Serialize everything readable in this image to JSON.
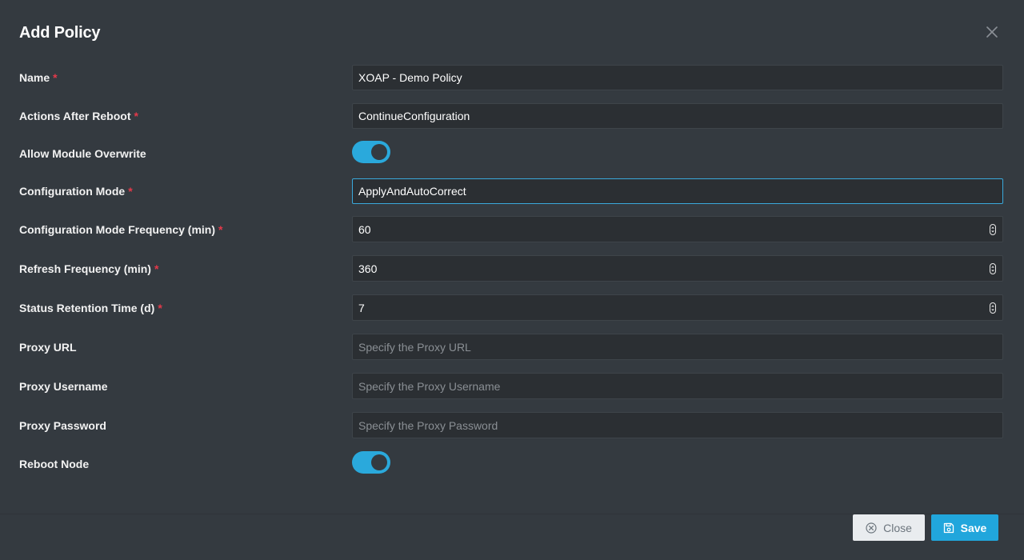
{
  "dialog": {
    "title": "Add Policy"
  },
  "form": {
    "name": {
      "label": "Name",
      "required": "*",
      "value": "XOAP - Demo Policy"
    },
    "actions_after_reboot": {
      "label": "Actions After Reboot",
      "required": "*",
      "value": "ContinueConfiguration"
    },
    "allow_module_overwrite": {
      "label": "Allow Module Overwrite",
      "on": true
    },
    "configuration_mode": {
      "label": "Configuration Mode",
      "required": "*",
      "value": "ApplyAndAutoCorrect"
    },
    "configuration_mode_frequency": {
      "label": "Configuration Mode Frequency (min)",
      "required": "*",
      "value": "60"
    },
    "refresh_frequency": {
      "label": "Refresh Frequency (min)",
      "required": "*",
      "value": "360"
    },
    "status_retention_time": {
      "label": "Status Retention Time (d)",
      "required": "*",
      "value": "7"
    },
    "proxy_url": {
      "label": "Proxy URL",
      "placeholder": "Specify the Proxy URL"
    },
    "proxy_username": {
      "label": "Proxy Username",
      "placeholder": "Specify the Proxy Username"
    },
    "proxy_password": {
      "label": "Proxy Password",
      "placeholder": "Specify the Proxy Password"
    },
    "reboot_node": {
      "label": "Reboot Node",
      "on": true
    }
  },
  "footer": {
    "close_label": "Close",
    "save_label": "Save"
  },
  "colors": {
    "background": "#343a40",
    "input_bg": "#2b2f33",
    "accent": "#21a6dc",
    "required": "#e4394a"
  },
  "icons": {
    "close": "close-icon",
    "close_button": "circle-x-icon",
    "save_button": "floppy-disk-icon",
    "number_spinner": "spinner-arrows-icon"
  }
}
